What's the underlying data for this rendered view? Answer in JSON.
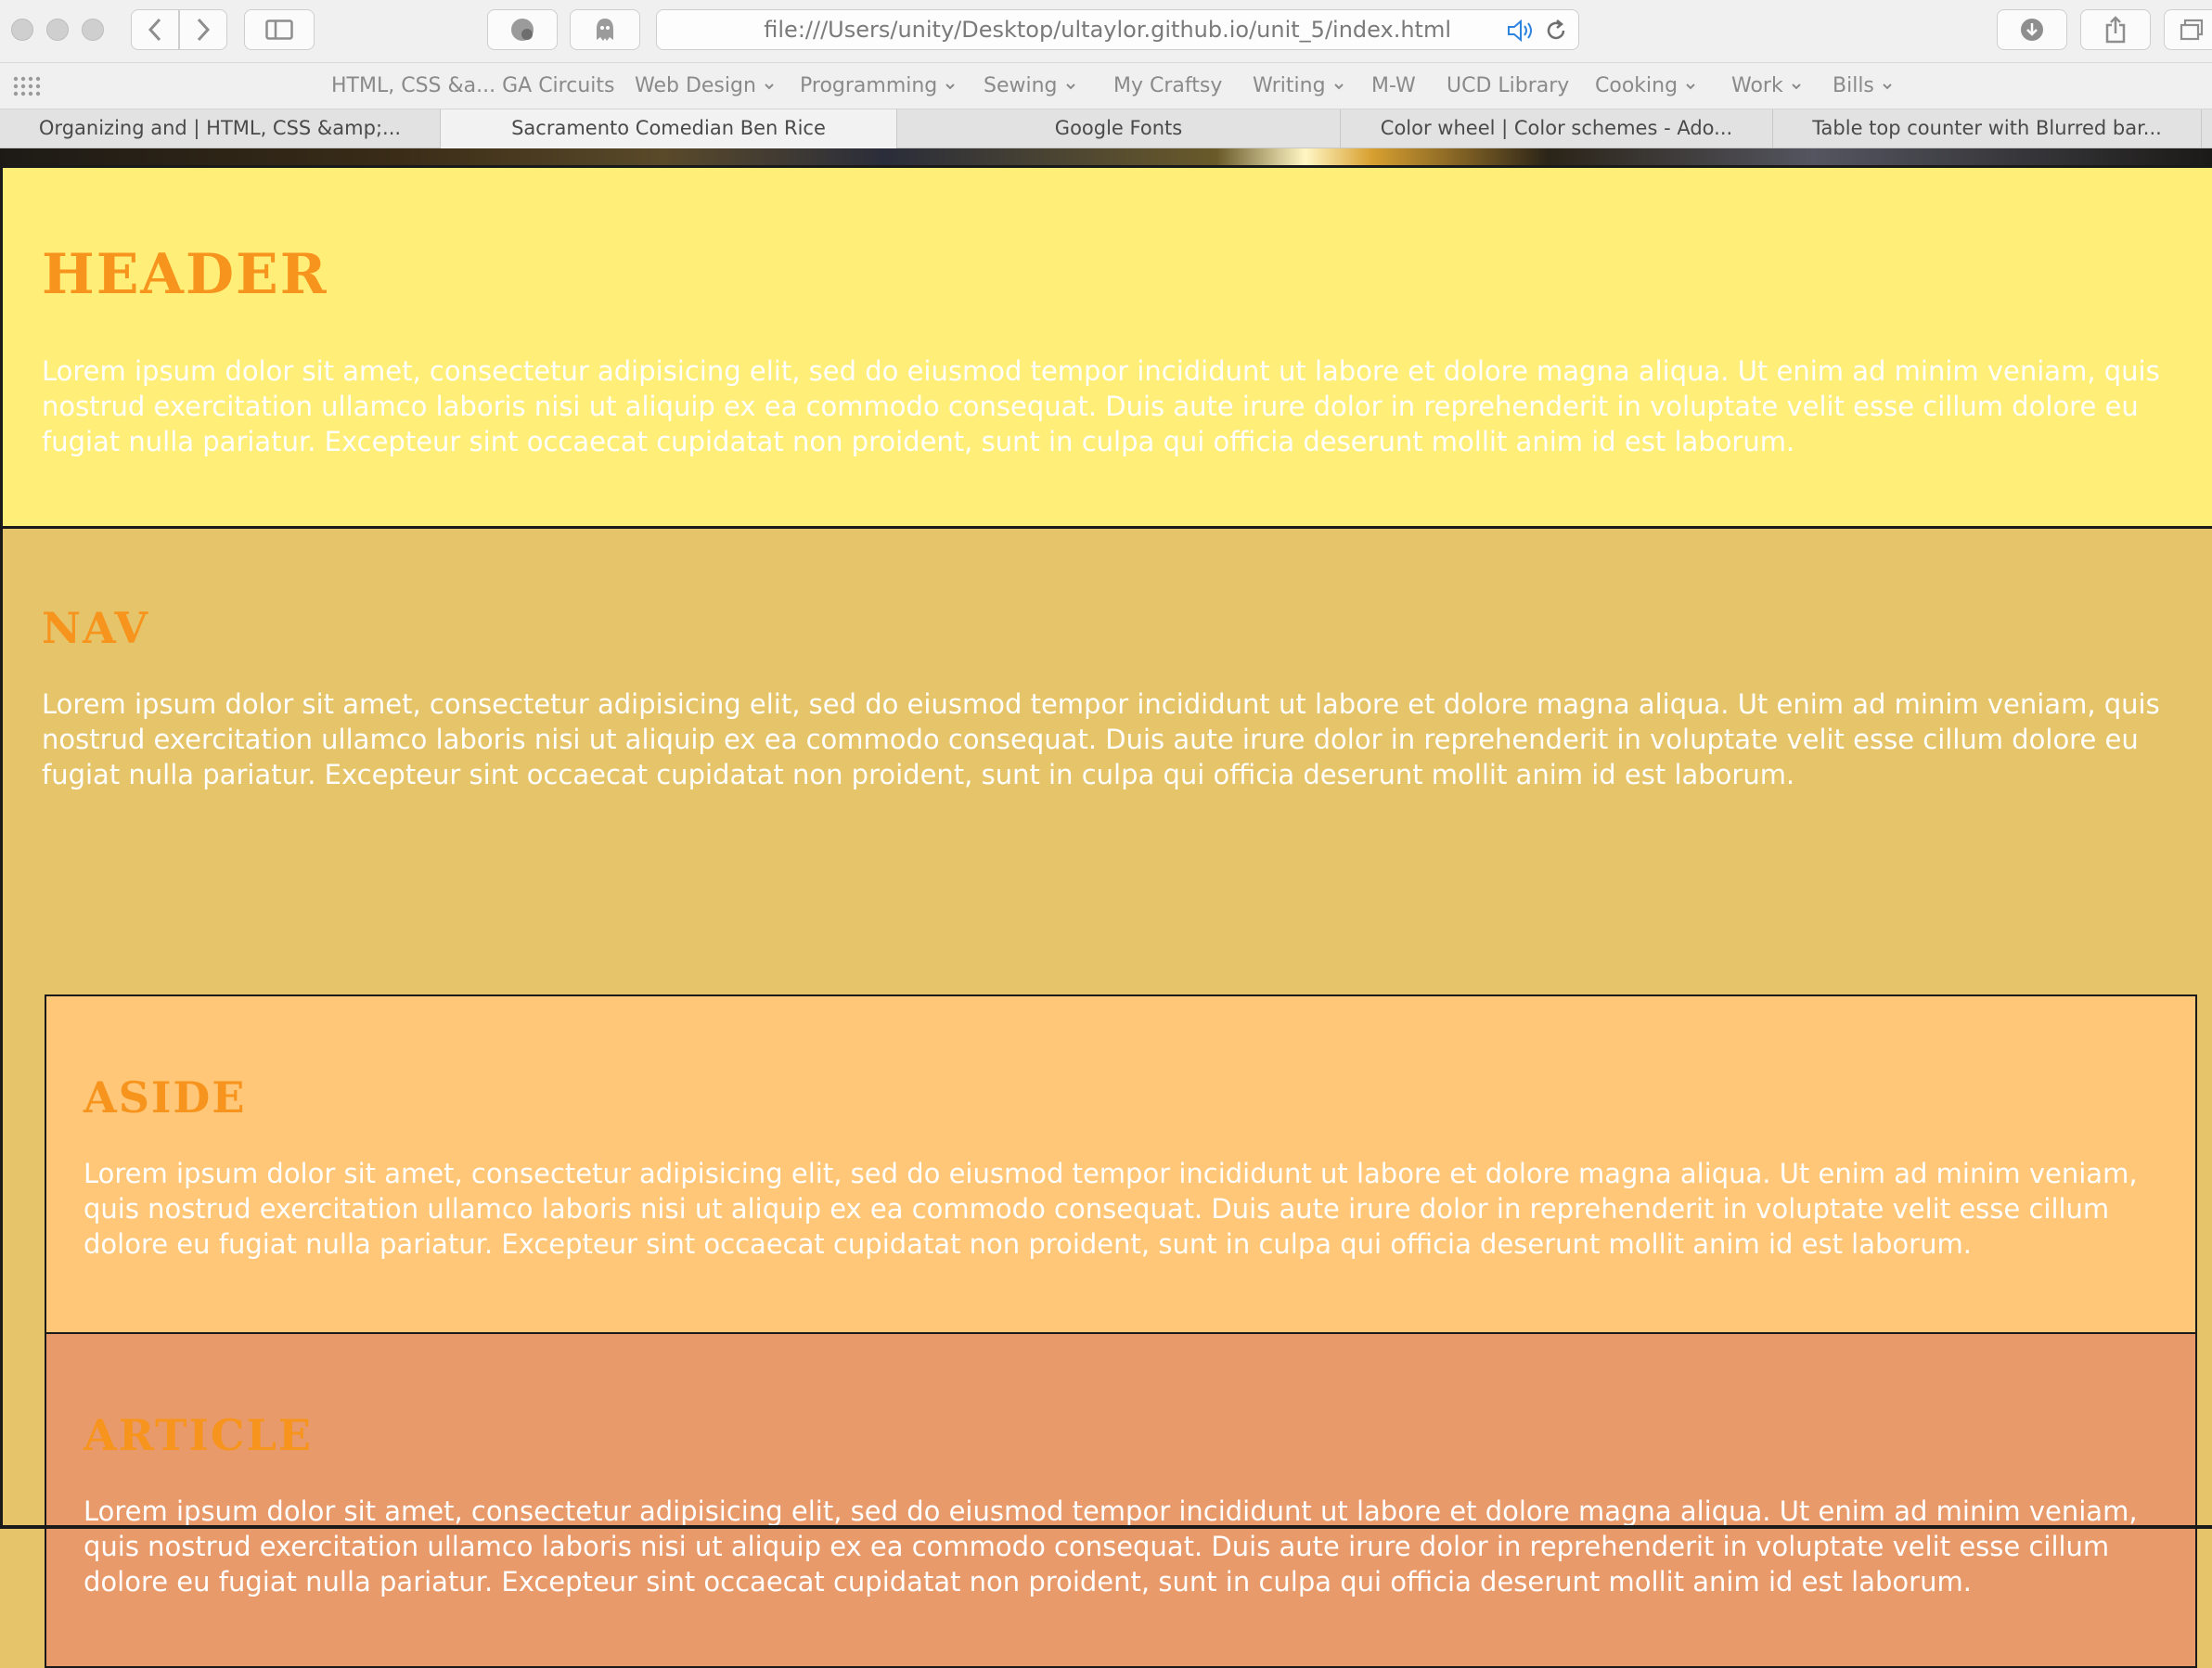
{
  "browser": {
    "url": "file:///Users/unity/Desktop/ultaylor.github.io/unit_5/index.html",
    "bookmarks": [
      {
        "label": "HTML, CSS &a... GA Circuits",
        "dropdown": false
      },
      {
        "label": "Web Design",
        "dropdown": true
      },
      {
        "label": "Programming",
        "dropdown": true
      },
      {
        "label": "Sewing",
        "dropdown": true
      },
      {
        "label": "My Craftsy",
        "dropdown": false
      },
      {
        "label": "Writing",
        "dropdown": true
      },
      {
        "label": "M-W",
        "dropdown": false
      },
      {
        "label": "UCD Library",
        "dropdown": false
      },
      {
        "label": "Cooking",
        "dropdown": true
      },
      {
        "label": "Work",
        "dropdown": true
      },
      {
        "label": "Bills",
        "dropdown": true
      }
    ],
    "tabs": [
      {
        "label": "Organizing and | HTML, CSS &amp;..."
      },
      {
        "label": "Sacramento Comedian Ben Rice"
      },
      {
        "label": "Google Fonts"
      },
      {
        "label": "Color wheel | Color schemes - Ado..."
      },
      {
        "label": "Table top counter with Blurred bar..."
      }
    ]
  },
  "page": {
    "header": {
      "title": "HEADER",
      "body": "Lorem ipsum dolor sit amet, consectetur adipisicing elit, sed do eiusmod tempor incididunt ut labore et dolore magna aliqua. Ut enim ad minim veniam, quis nostrud exercitation ullamco laboris nisi ut aliquip ex ea commodo consequat. Duis aute irure dolor in reprehenderit in voluptate velit esse cillum dolore eu fugiat nulla pariatur. Excepteur sint occaecat cupidatat non proident, sunt in culpa qui officia deserunt mollit anim id est laborum."
    },
    "nav": {
      "title": "NAV",
      "body": "Lorem ipsum dolor sit amet, consectetur adipisicing elit, sed do eiusmod tempor incididunt ut labore et dolore magna aliqua. Ut enim ad minim veniam, quis nostrud exercitation ullamco laboris nisi ut aliquip ex ea commodo consequat. Duis aute irure dolor in reprehenderit in voluptate velit esse cillum dolore eu fugiat nulla pariatur. Excepteur sint occaecat cupidatat non proident, sunt in culpa qui officia deserunt mollit anim id est laborum."
    },
    "aside": {
      "title": "ASIDE",
      "body": "Lorem ipsum dolor sit amet, consectetur adipisicing elit, sed do eiusmod tempor incididunt ut labore et dolore magna aliqua. Ut enim ad minim veniam, quis nostrud exercitation ullamco laboris nisi ut aliquip ex ea commodo consequat. Duis aute irure dolor in reprehenderit in voluptate velit esse cillum dolore eu fugiat nulla pariatur. Excepteur sint occaecat cupidatat non proident, sunt in culpa qui officia deserunt mollit anim id est laborum."
    },
    "article": {
      "title": "ARTICLE",
      "body": "Lorem ipsum dolor sit amet, consectetur adipisicing elit, sed do eiusmod tempor incididunt ut labore et dolore magna aliqua. Ut enim ad minim veniam, quis nostrud exercitation ullamco laboris nisi ut aliquip ex ea commodo consequat. Duis aute irure dolor in reprehenderit in voluptate velit esse cillum dolore eu fugiat nulla pariatur. Excepteur sint occaecat cupidatat non proident, sunt in culpa qui officia deserunt mollit anim id est laborum."
    }
  },
  "colors": {
    "header_bg": "#ffee78",
    "nav_bg": "#e6c46a",
    "aside_bg": "#ffc777",
    "article_bg": "#e89a6a",
    "title_color": "#f7941d",
    "body_text": "#ffffff"
  }
}
